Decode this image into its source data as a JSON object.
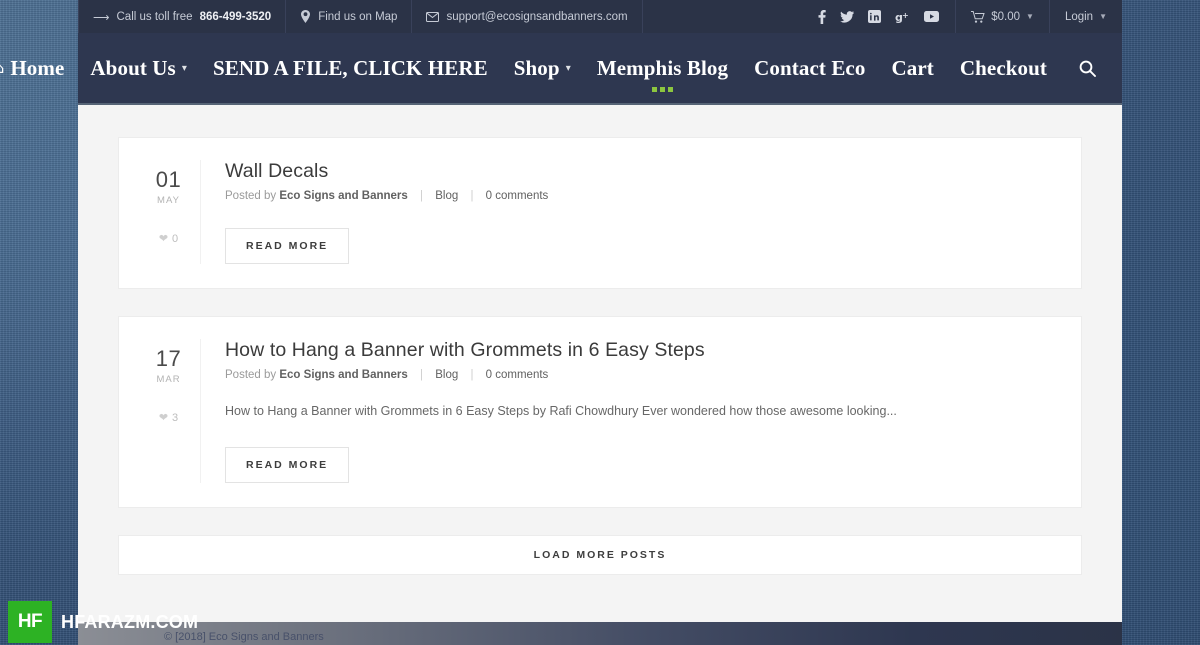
{
  "topbar": {
    "arrow_icon": "arrow-right-icon",
    "phone_prefix": "Call us toll free ",
    "phone": "866-499-3520",
    "map_icon": "map-pin-icon",
    "map_label": "Find us on Map",
    "mail_icon": "envelope-icon",
    "email": "support@ecosignsandbanners.com",
    "social": [
      {
        "name": "facebook-icon",
        "glyph": "f"
      },
      {
        "name": "twitter-icon",
        "glyph": "✉"
      },
      {
        "name": "linkedin-icon",
        "glyph": "in"
      },
      {
        "name": "googleplus-icon",
        "glyph": "g+"
      },
      {
        "name": "youtube-icon",
        "glyph": "▶"
      }
    ],
    "cart_icon": "shopping-cart-icon",
    "cart_total": "$0.00",
    "cart_caret": "⌄",
    "login_label": "Login",
    "login_caret": "⌄"
  },
  "nav": {
    "items": [
      {
        "label": "Home",
        "icon": "home-icon",
        "caret": false,
        "active": false
      },
      {
        "label": "About Us",
        "icon": null,
        "caret": true,
        "active": false
      },
      {
        "label": "SEND A FILE, CLICK HERE",
        "icon": null,
        "caret": false,
        "active": false
      },
      {
        "label": "Shop",
        "icon": null,
        "caret": true,
        "active": false
      },
      {
        "label": "Memphis Blog",
        "icon": null,
        "caret": false,
        "active": true
      },
      {
        "label": "Contact Eco",
        "icon": null,
        "caret": false,
        "active": false
      },
      {
        "label": "Cart",
        "icon": null,
        "caret": false,
        "active": false
      },
      {
        "label": "Checkout",
        "icon": null,
        "caret": false,
        "active": false
      }
    ],
    "search_icon": "search-icon",
    "active_dot_color": "#8cc63f"
  },
  "posts": [
    {
      "day": "01",
      "month": "MAY",
      "like_icon": "heart-icon",
      "likes": "0",
      "title": "Wall Decals",
      "posted_by_label": "Posted by",
      "author": "Eco Signs and Banners",
      "category": "Blog",
      "comments": "0 comments",
      "excerpt": "",
      "read_more": "READ MORE"
    },
    {
      "day": "17",
      "month": "MAR",
      "like_icon": "heart-icon",
      "likes": "3",
      "title": "How to Hang a Banner with Grommets in 6 Easy Steps",
      "posted_by_label": "Posted by",
      "author": "Eco Signs and Banners",
      "category": "Blog",
      "comments": "0 comments",
      "excerpt": "How to Hang a Banner with Grommets in 6 Easy Steps by Rafi Chowdhury Ever wondered how those awesome looking...",
      "read_more": "READ MORE"
    }
  ],
  "load_more": {
    "label": "LOAD MORE POSTS"
  },
  "footer": {
    "text": "© [2018] Eco Signs and Banners"
  },
  "watermark": {
    "badge": "HF",
    "text": "HFARAZM.COM",
    "color": "#2db224"
  },
  "colors": {
    "topbar_bg": "#2b3347",
    "nav_bg": "#2e3750",
    "page_bg": "#f4f4f4",
    "card_bg": "#ffffff",
    "accent_green": "#8cc63f"
  }
}
